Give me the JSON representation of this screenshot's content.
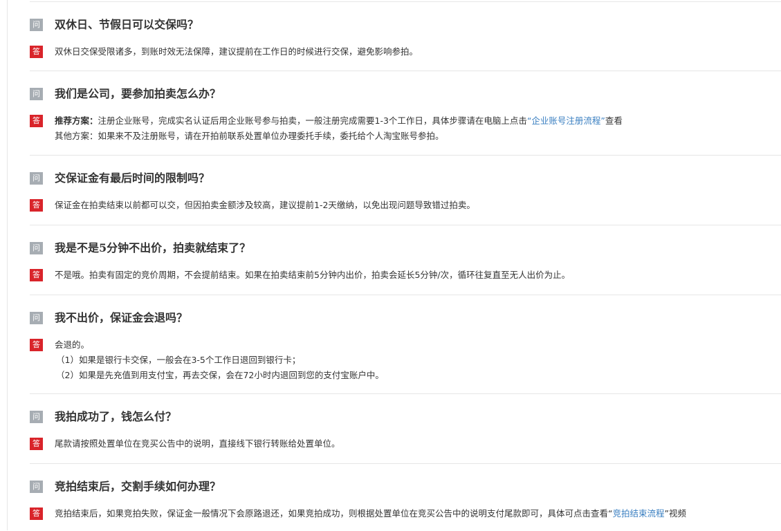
{
  "badges": {
    "question": "问",
    "answer": "答"
  },
  "faq": [
    {
      "question": "双休日、节假日可以交保吗？",
      "answer": "双休日交保受限诸多，到账时效无法保障，建议提前在工作日的时候进行交保，避免影响参拍。"
    },
    {
      "question": "我们是公司，要参加拍卖怎么办？",
      "answer_line1_label": "推荐方案：",
      "answer_line1_text": "注册企业账号，完成实名认证后用企业账号参与拍卖，一般注册完成需要1-3个工作日，具体步骤请在电脑上点击",
      "answer_line1_link": "“企业账号注册流程”",
      "answer_line1_tail": "查看",
      "answer_line2": "其他方案：如果来不及注册账号，请在开拍前联系处置单位办理委托手续，委托给个人淘宝账号参拍。"
    },
    {
      "question": "交保证金有最后时间的限制吗？",
      "answer": "保证金在拍卖结束以前都可以交，但因拍卖金额涉及较高，建议提前1-2天缴纳，以免出现问题导致错过拍卖。"
    },
    {
      "question": "我是不是5分钟不出价，拍卖就结束了？",
      "answer": "不是哦。拍卖有固定的竞价周期，不会提前结束。如果在拍卖结束前5分钟内出价，拍卖会延长5分钟/次，循环往复直至无人出价为止。"
    },
    {
      "question": "我不出价，保证金会退吗？",
      "answer_line1": "会退的。",
      "answer_line2": "（1）如果是银行卡交保，一般会在3-5个工作日退回到银行卡；",
      "answer_line3": "（2）如果是先充值到用支付宝，再去交保，会在72小时内退回到您的支付宝账户中。"
    },
    {
      "question": "我拍成功了，钱怎么付？",
      "answer": "尾款请按照处置单位在竞买公告中的说明，直接线下银行转账给处置单位。"
    },
    {
      "question": "竞拍结束后，交割手续如何办理？",
      "answer_text": "竞拍结束后，如果竞拍失败，保证金一般情况下会原路退还，如果竞拍成功，则根据处置单位在竞买公告中的说明支付尾款即可，具体可点击查看“",
      "answer_link": "竞拍结束流程",
      "answer_tail": "”视频"
    }
  ]
}
